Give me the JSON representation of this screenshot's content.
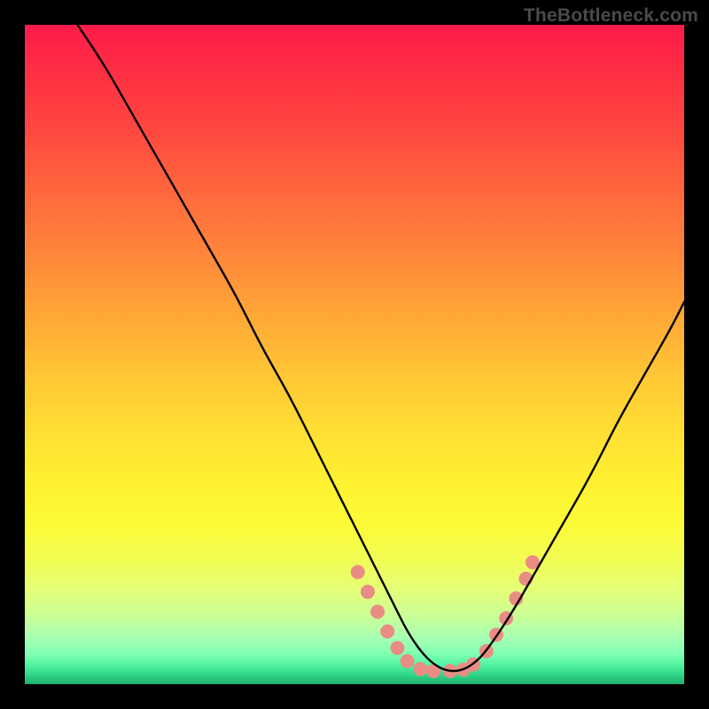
{
  "watermark": "TheBottleneck.com",
  "chart_data": {
    "type": "line",
    "title": "",
    "xlabel": "",
    "ylabel": "",
    "xlim": [
      0,
      100
    ],
    "ylim": [
      0,
      100
    ],
    "grid": false,
    "legend": false,
    "series": [
      {
        "name": "bottleneck-curve",
        "color": "#000000",
        "x": [
          8,
          12,
          16,
          20,
          24,
          28,
          32,
          36,
          40,
          44,
          48,
          52,
          56,
          58,
          60,
          62,
          64,
          66,
          68,
          70,
          74,
          78,
          82,
          86,
          90,
          94,
          98,
          100
        ],
        "y": [
          100,
          94,
          87,
          80,
          73,
          66,
          59,
          51,
          44,
          36,
          28,
          20,
          12,
          8,
          5,
          3,
          2,
          2,
          3,
          5,
          11,
          18,
          25,
          32,
          40,
          47,
          54,
          58
        ]
      }
    ],
    "markers": {
      "name": "highlight-dots",
      "color": "#e98d84",
      "radius_px": 8,
      "points": [
        {
          "x": 50.5,
          "y": 17
        },
        {
          "x": 52,
          "y": 14
        },
        {
          "x": 53.5,
          "y": 11
        },
        {
          "x": 55,
          "y": 8
        },
        {
          "x": 56.5,
          "y": 5.5
        },
        {
          "x": 58,
          "y": 3.5
        },
        {
          "x": 60,
          "y": 2.3
        },
        {
          "x": 62,
          "y": 2
        },
        {
          "x": 64.5,
          "y": 2
        },
        {
          "x": 66.5,
          "y": 2.2
        },
        {
          "x": 68,
          "y": 3
        },
        {
          "x": 70,
          "y": 5
        },
        {
          "x": 71.5,
          "y": 7.5
        },
        {
          "x": 73,
          "y": 10
        },
        {
          "x": 74.5,
          "y": 13
        },
        {
          "x": 76,
          "y": 16
        },
        {
          "x": 77,
          "y": 18.5
        }
      ]
    },
    "background_gradient": {
      "top": "#ff1a4b",
      "mid": "#fff231",
      "bottom": "#1fb06e"
    }
  }
}
